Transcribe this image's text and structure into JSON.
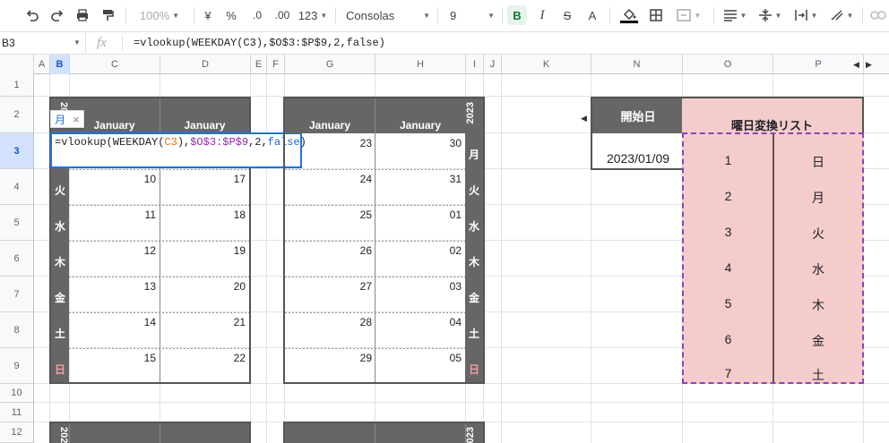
{
  "toolbar": {
    "zoom": "100%",
    "currency": "¥",
    "percent": "%",
    "decrease_decimal": ".0",
    "increase_decimal": ".00",
    "number_format": "123",
    "font": "Consolas",
    "font_size": "9"
  },
  "formula_bar": {
    "cell_ref": "B3",
    "fx": "fx",
    "formula": "=vlookup(WEEKDAY(C3),$O$3:$P$9,2,false)"
  },
  "columns": [
    "A",
    "B",
    "C",
    "D",
    "E",
    "F",
    "G",
    "H",
    "I",
    "J",
    "K",
    "N",
    "O",
    "P"
  ],
  "rows": [
    "1",
    "2",
    "3",
    "4",
    "5",
    "6",
    "7",
    "8",
    "9",
    "10",
    "11",
    "12"
  ],
  "calendar1": {
    "year": "2023",
    "month_headers": [
      "January",
      "January"
    ],
    "col_c": [
      "",
      "10",
      "11",
      "12",
      "13",
      "14",
      "15"
    ],
    "col_d": [
      "",
      "17",
      "18",
      "19",
      "20",
      "21",
      "22"
    ],
    "weekdays": [
      "月",
      "火",
      "水",
      "木",
      "金",
      "土",
      "日"
    ]
  },
  "calendar2": {
    "year": "2023",
    "month_headers": [
      "January",
      "January"
    ],
    "col_g": [
      "23",
      "24",
      "25",
      "26",
      "27",
      "28",
      "29"
    ],
    "col_h": [
      "30",
      "31",
      "01",
      "02",
      "03",
      "04",
      "05"
    ],
    "weekdays": [
      "月",
      "火",
      "水",
      "木",
      "金",
      "土",
      "日"
    ]
  },
  "editor": {
    "chip": "月",
    "chip_close": "×",
    "text_prefix": "=vlookup(WEEKDAY(",
    "ref1": "C3",
    "sep1": "),",
    "ref2": "$O$3:$P$9",
    "text_mid": ",2,",
    "bool": "false",
    "text_end": ")"
  },
  "start_date": {
    "label": "開始日",
    "value": "2023/01/09"
  },
  "weekday_list": {
    "title": "曜日変換リスト",
    "numbers": [
      "1",
      "2",
      "3",
      "4",
      "5",
      "6",
      "7"
    ],
    "names": [
      "日",
      "月",
      "火",
      "水",
      "木",
      "金",
      "土"
    ]
  },
  "colors": {
    "accent_blue": "#1a73e8",
    "dark_header": "#666666",
    "pink_fill": "#f4cccc",
    "sunday_red": "#f4cccc"
  }
}
